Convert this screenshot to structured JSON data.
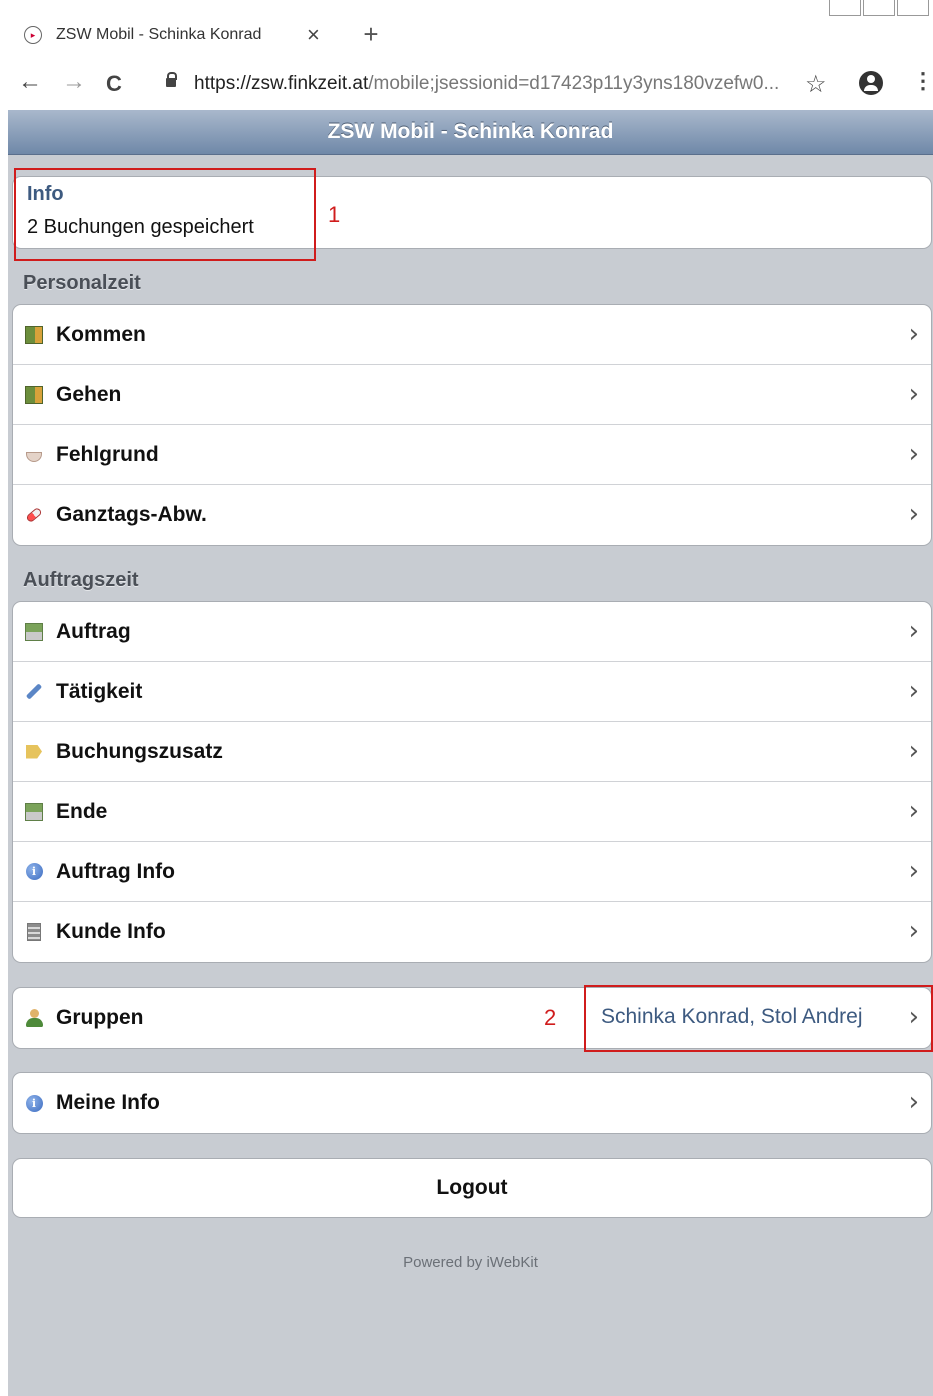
{
  "browser": {
    "tab_title": "ZSW Mobil - Schinka Konrad",
    "tab_close": "×",
    "new_tab": "+",
    "back": "←",
    "forward": "→",
    "reload": "C",
    "url_host": "https://zsw.finkzeit.at",
    "url_rest": "/mobile;jsessionid=d17423p11y3yns180vzefw0...",
    "star": "☆",
    "menu": "⋮"
  },
  "app": {
    "header_title": "ZSW Mobil - Schinka Konrad",
    "info": {
      "title": "Info",
      "text": "2 Buchungen gespeichert"
    },
    "sections": {
      "personalzeit": "Personalzeit",
      "auftragszeit": "Auftragszeit"
    },
    "personalzeit_items": [
      {
        "label": "Kommen",
        "icon": "door-in-icon"
      },
      {
        "label": "Gehen",
        "icon": "door-out-icon"
      },
      {
        "label": "Fehlgrund",
        "icon": "coffee-cup-icon"
      },
      {
        "label": "Ganztags-Abw.",
        "icon": "pill-icon"
      }
    ],
    "auftragszeit_items": [
      {
        "label": "Auftrag",
        "icon": "tree-icon"
      },
      {
        "label": "Tätigkeit",
        "icon": "wrench-icon"
      },
      {
        "label": "Buchungszusatz",
        "icon": "tag-icon"
      },
      {
        "label": "Ende",
        "icon": "tree-end-icon"
      },
      {
        "label": "Auftrag Info",
        "icon": "info-icon"
      },
      {
        "label": "Kunde Info",
        "icon": "building-icon"
      }
    ],
    "gruppen": {
      "label": "Gruppen",
      "value": "Schinka Konrad, Stol Andrej",
      "icon": "people-icon"
    },
    "meine_info": {
      "label": "Meine Info",
      "icon": "info-icon"
    },
    "logout": "Logout",
    "footer": "Powered by iWebKit",
    "chevron": "›"
  },
  "annotations": {
    "one": "1",
    "two": "2",
    "color": "#d01c1c"
  },
  "colors": {
    "header": "#7f95b3",
    "background": "#c8ccd2",
    "accent_text": "#3d5a80"
  }
}
